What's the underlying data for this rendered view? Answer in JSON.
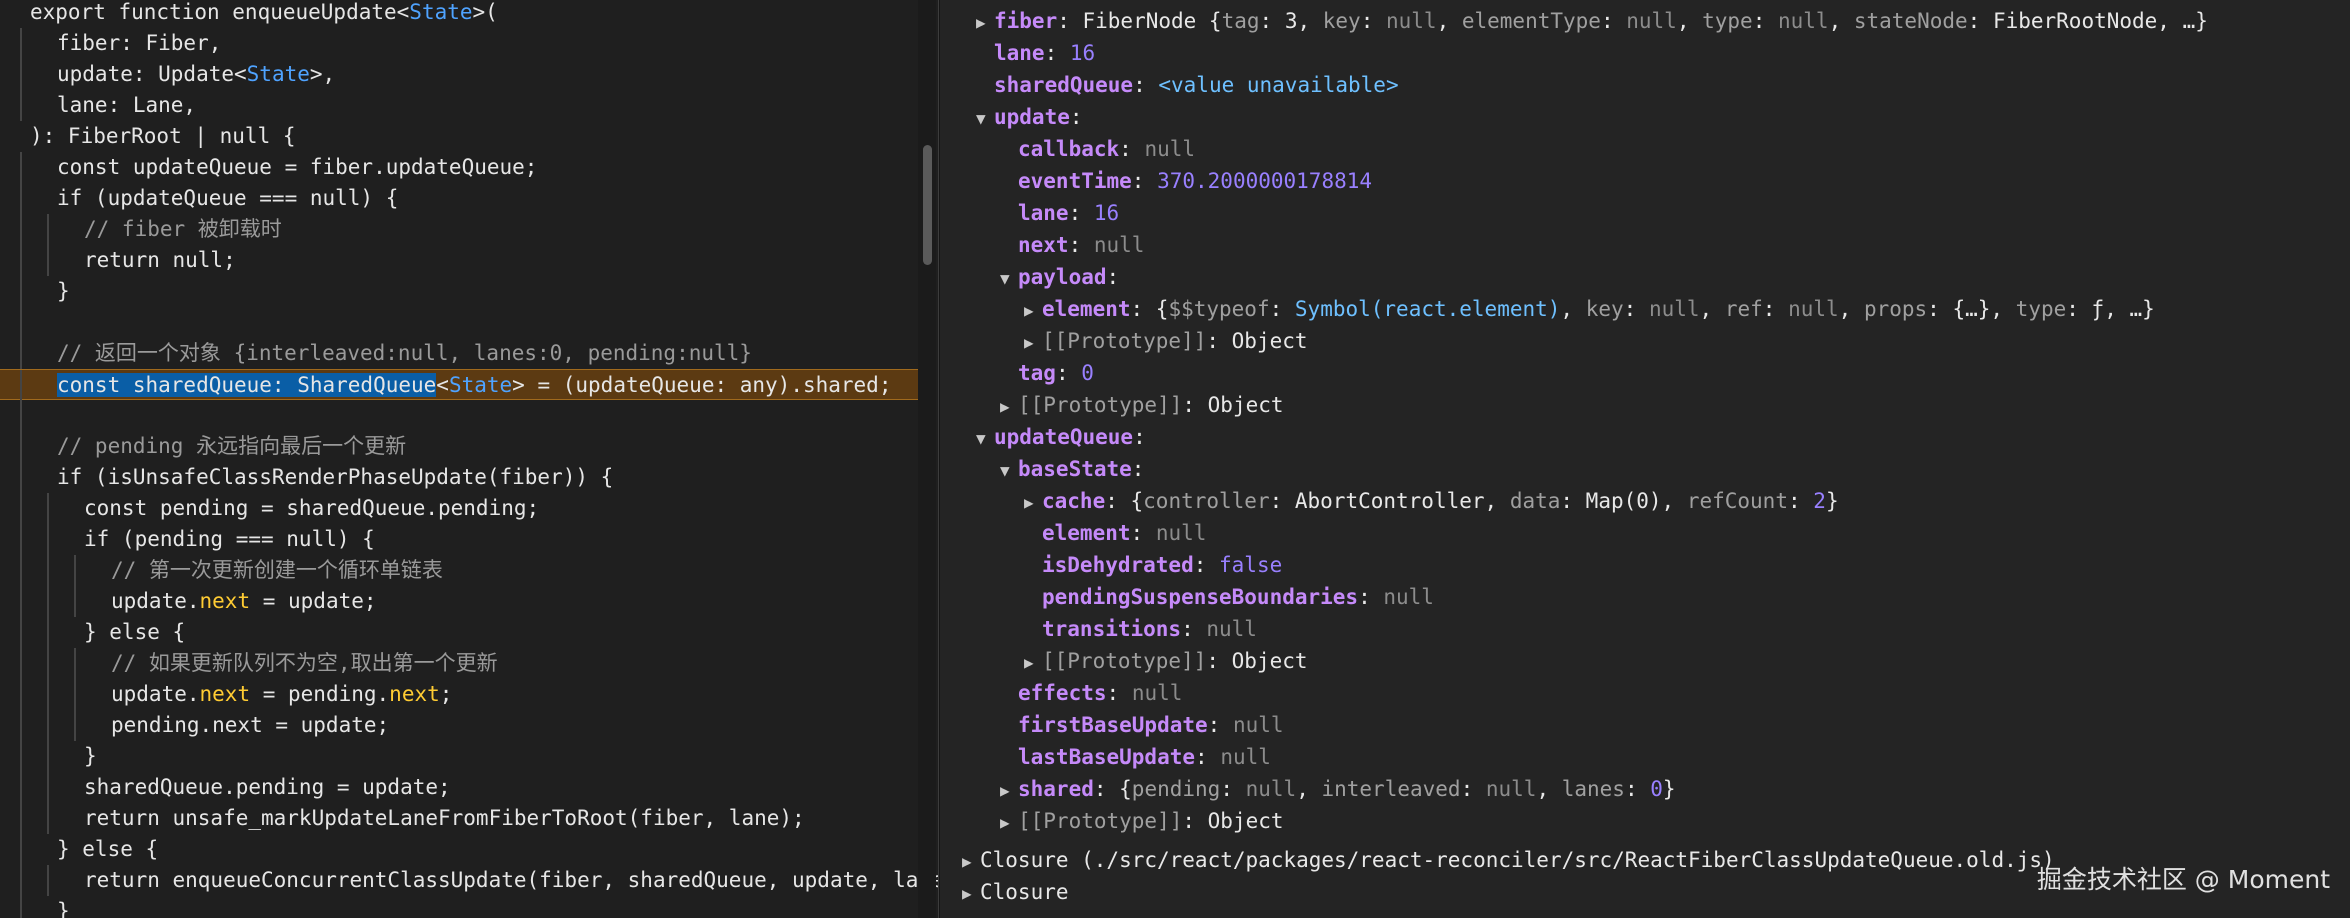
{
  "code_lines": [
    {
      "text": "export function enqueueUpdate<State>(",
      "indent": 0,
      "segments": [
        [
          "export function enqueueUpdate<",
          ""
        ],
        [
          "State",
          "c-type"
        ],
        [
          ">(",
          ""
        ]
      ]
    },
    {
      "text": "fiber: Fiber,",
      "indent": 1
    },
    {
      "text": "update: Update<State>,",
      "indent": 1,
      "segments": [
        [
          "update: Update<",
          ""
        ],
        [
          "State",
          "c-type"
        ],
        [
          ">,",
          ""
        ]
      ]
    },
    {
      "text": "lane: Lane,",
      "indent": 1
    },
    {
      "text": "): FiberRoot | null {",
      "indent": 0
    },
    {
      "text": "const updateQueue = fiber.updateQueue;",
      "indent": 1
    },
    {
      "text": "if (updateQueue === null) {",
      "indent": 1
    },
    {
      "text": "// fiber 被卸载时",
      "indent": 2,
      "cls": "c-comment"
    },
    {
      "text": "return null;",
      "indent": 2
    },
    {
      "text": "}",
      "indent": 1
    },
    {
      "text": "",
      "indent": 1
    },
    {
      "text": "// 返回一个对象 {interleaved:null, lanes:0, pending:null}",
      "indent": 1,
      "cls": "c-comment"
    },
    {
      "text": "const sharedQueue: SharedQueue<State> = (updateQueue: any).shared;",
      "indent": 1,
      "highlight": true,
      "segments": [
        [
          "const sharedQueue: SharedQueue",
          "sel"
        ],
        [
          "<",
          ""
        ],
        [
          "State",
          "c-type"
        ],
        [
          "> = (updateQueue: any).shared;",
          ""
        ]
      ]
    },
    {
      "text": "",
      "indent": 1
    },
    {
      "text": "// pending 永远指向最后一个更新",
      "indent": 1,
      "cls": "c-comment"
    },
    {
      "text": "if (isUnsafeClassRenderPhaseUpdate(fiber)) {",
      "indent": 1
    },
    {
      "text": "const pending = sharedQueue.pending;",
      "indent": 2
    },
    {
      "text": "if (pending === null) {",
      "indent": 2
    },
    {
      "text": "// 第一次更新创建一个循环单链表",
      "indent": 3,
      "cls": "c-comment"
    },
    {
      "text": "update.next = update;",
      "indent": 3,
      "segments": [
        [
          "update.",
          ""
        ],
        [
          "next",
          "c-prop"
        ],
        [
          " = update;",
          ""
        ]
      ]
    },
    {
      "text": "} else {",
      "indent": 2
    },
    {
      "text": "// 如果更新队列不为空,取出第一个更新",
      "indent": 3,
      "cls": "c-comment"
    },
    {
      "text": "update.next = pending.next;",
      "indent": 3,
      "segments": [
        [
          "update.",
          ""
        ],
        [
          "next",
          "c-prop"
        ],
        [
          " = pending.",
          ""
        ],
        [
          "next",
          "c-prop"
        ],
        [
          ";",
          ""
        ]
      ]
    },
    {
      "text": "pending.next = update;",
      "indent": 3
    },
    {
      "text": "}",
      "indent": 2
    },
    {
      "text": "sharedQueue.pending = update;",
      "indent": 2
    },
    {
      "text": "return unsafe_markUpdateLaneFromFiberToRoot(fiber, lane);",
      "indent": 2
    },
    {
      "text": "} else {",
      "indent": 1
    },
    {
      "text": "return enqueueConcurrentClassUpdate(fiber, sharedQueue, update, lane);",
      "indent": 2
    },
    {
      "text": "}",
      "indent": 1
    }
  ],
  "scope_rows": [
    {
      "depth": 0,
      "tri": "right",
      "parts": [
        [
          "fiber",
          "k"
        ],
        [
          ": FiberNode {",
          "v"
        ],
        [
          "tag",
          "v-key2"
        ],
        [
          ": 3, ",
          "v"
        ],
        [
          "key",
          "v-key2"
        ],
        [
          ": ",
          "v"
        ],
        [
          "null",
          "v-null"
        ],
        [
          ", ",
          "v"
        ],
        [
          "elementType",
          "v-key2"
        ],
        [
          ": ",
          "v"
        ],
        [
          "null",
          "v-null"
        ],
        [
          ", ",
          "v"
        ],
        [
          "type",
          "v-key2"
        ],
        [
          ": ",
          "v"
        ],
        [
          "null",
          "v-null"
        ],
        [
          ", ",
          "v"
        ],
        [
          "stateNode",
          "v-key2"
        ],
        [
          ": FiberRootNode, …}",
          "v"
        ]
      ]
    },
    {
      "depth": 0,
      "tri": "",
      "parts": [
        [
          "lane",
          "k"
        ],
        [
          ": ",
          "v"
        ],
        [
          "16",
          "v-num"
        ]
      ]
    },
    {
      "depth": 0,
      "tri": "",
      "parts": [
        [
          "sharedQueue",
          "k"
        ],
        [
          ": ",
          "v"
        ],
        [
          "<value unavailable>",
          "v-str"
        ]
      ]
    },
    {
      "depth": 0,
      "tri": "down",
      "parts": [
        [
          "update",
          "k"
        ],
        [
          ":",
          "v"
        ]
      ]
    },
    {
      "depth": 1,
      "tri": "",
      "parts": [
        [
          "callback",
          "k"
        ],
        [
          ": ",
          "v"
        ],
        [
          "null",
          "v-null"
        ]
      ]
    },
    {
      "depth": 1,
      "tri": "",
      "parts": [
        [
          "eventTime",
          "k"
        ],
        [
          ": ",
          "v"
        ],
        [
          "370.2000000178814",
          "v-num"
        ]
      ]
    },
    {
      "depth": 1,
      "tri": "",
      "parts": [
        [
          "lane",
          "k"
        ],
        [
          ": ",
          "v"
        ],
        [
          "16",
          "v-num"
        ]
      ]
    },
    {
      "depth": 1,
      "tri": "",
      "parts": [
        [
          "next",
          "k"
        ],
        [
          ": ",
          "v"
        ],
        [
          "null",
          "v-null"
        ]
      ]
    },
    {
      "depth": 1,
      "tri": "down",
      "parts": [
        [
          "payload",
          "k"
        ],
        [
          ":",
          "v"
        ]
      ]
    },
    {
      "depth": 2,
      "tri": "right",
      "parts": [
        [
          "element",
          "k"
        ],
        [
          ": {",
          "v"
        ],
        [
          "$$typeof",
          "v-key2"
        ],
        [
          ": ",
          "v"
        ],
        [
          "Symbol(react.element)",
          "v-sym"
        ],
        [
          ", ",
          "v"
        ],
        [
          "key",
          "v-key2"
        ],
        [
          ": ",
          "v"
        ],
        [
          "null",
          "v-null"
        ],
        [
          ", ",
          "v"
        ],
        [
          "ref",
          "v-key2"
        ],
        [
          ": ",
          "v"
        ],
        [
          "null",
          "v-null"
        ],
        [
          ", ",
          "v"
        ],
        [
          "props",
          "v-key2"
        ],
        [
          ": {…}, ",
          "v"
        ],
        [
          "type",
          "v-key2"
        ],
        [
          ": ",
          "v"
        ],
        [
          "ƒ",
          "v"
        ],
        [
          ", …}",
          "v"
        ]
      ]
    },
    {
      "depth": 2,
      "tri": "right",
      "parts": [
        [
          "[[Prototype]]",
          "v-key2"
        ],
        [
          ": Object",
          "v"
        ]
      ]
    },
    {
      "depth": 1,
      "tri": "",
      "parts": [
        [
          "tag",
          "k"
        ],
        [
          ": ",
          "v"
        ],
        [
          "0",
          "v-num"
        ]
      ]
    },
    {
      "depth": 1,
      "tri": "right",
      "parts": [
        [
          "[[Prototype]]",
          "v-key2"
        ],
        [
          ": Object",
          "v"
        ]
      ]
    },
    {
      "depth": 0,
      "tri": "down",
      "parts": [
        [
          "updateQueue",
          "k"
        ],
        [
          ":",
          "v"
        ]
      ]
    },
    {
      "depth": 1,
      "tri": "down",
      "parts": [
        [
          "baseState",
          "k"
        ],
        [
          ":",
          "v"
        ]
      ]
    },
    {
      "depth": 2,
      "tri": "right",
      "parts": [
        [
          "cache",
          "k"
        ],
        [
          ": {",
          "v"
        ],
        [
          "controller",
          "v-key2"
        ],
        [
          ": AbortController, ",
          "v"
        ],
        [
          "data",
          "v-key2"
        ],
        [
          ": Map(0), ",
          "v"
        ],
        [
          "refCount",
          "v-key2"
        ],
        [
          ": ",
          "v"
        ],
        [
          "2",
          "v-num"
        ],
        [
          "}",
          "v"
        ]
      ]
    },
    {
      "depth": 2,
      "tri": "",
      "parts": [
        [
          "element",
          "k"
        ],
        [
          ": ",
          "v"
        ],
        [
          "null",
          "v-null"
        ]
      ]
    },
    {
      "depth": 2,
      "tri": "",
      "parts": [
        [
          "isDehydrated",
          "k"
        ],
        [
          ": ",
          "v"
        ],
        [
          "false",
          "v-bool"
        ]
      ]
    },
    {
      "depth": 2,
      "tri": "",
      "parts": [
        [
          "pendingSuspenseBoundaries",
          "k"
        ],
        [
          ": ",
          "v"
        ],
        [
          "null",
          "v-null"
        ]
      ]
    },
    {
      "depth": 2,
      "tri": "",
      "parts": [
        [
          "transitions",
          "k"
        ],
        [
          ": ",
          "v"
        ],
        [
          "null",
          "v-null"
        ]
      ]
    },
    {
      "depth": 2,
      "tri": "right",
      "parts": [
        [
          "[[Prototype]]",
          "v-key2"
        ],
        [
          ": Object",
          "v"
        ]
      ]
    },
    {
      "depth": 1,
      "tri": "",
      "parts": [
        [
          "effects",
          "k"
        ],
        [
          ": ",
          "v"
        ],
        [
          "null",
          "v-null"
        ]
      ]
    },
    {
      "depth": 1,
      "tri": "",
      "parts": [
        [
          "firstBaseUpdate",
          "k"
        ],
        [
          ": ",
          "v"
        ],
        [
          "null",
          "v-null"
        ]
      ]
    },
    {
      "depth": 1,
      "tri": "",
      "parts": [
        [
          "lastBaseUpdate",
          "k"
        ],
        [
          ": ",
          "v"
        ],
        [
          "null",
          "v-null"
        ]
      ]
    },
    {
      "depth": 1,
      "tri": "right",
      "parts": [
        [
          "shared",
          "k"
        ],
        [
          ": {",
          "v"
        ],
        [
          "pending",
          "v-key2"
        ],
        [
          ": ",
          "v"
        ],
        [
          "null",
          "v-null"
        ],
        [
          ", ",
          "v"
        ],
        [
          "interleaved",
          "v-key2"
        ],
        [
          ": ",
          "v"
        ],
        [
          "null",
          "v-null"
        ],
        [
          ", ",
          "v"
        ],
        [
          "lanes",
          "v-key2"
        ],
        [
          ": ",
          "v"
        ],
        [
          "0",
          "v-num"
        ],
        [
          "}",
          "v"
        ]
      ]
    },
    {
      "depth": 1,
      "tri": "right",
      "parts": [
        [
          "[[Prototype]]",
          "v-key2"
        ],
        [
          ": Object",
          "v"
        ]
      ]
    },
    {
      "depth": -1,
      "tri": "right",
      "parts": [
        [
          "Closure (./src/react/packages/react-reconciler/src/ReactFiberClassUpdateQueue.old.js)",
          "v"
        ]
      ]
    },
    {
      "depth": -1,
      "tri": "right",
      "parts": [
        [
          "Closure",
          "v"
        ]
      ]
    }
  ],
  "watermark": "掘金技术社区 @ Moment",
  "colors": {
    "keyword": "#c58af9",
    "type": "#4fa3ff",
    "highlight": "#5c3a12",
    "selection": "#0a5ea6"
  }
}
